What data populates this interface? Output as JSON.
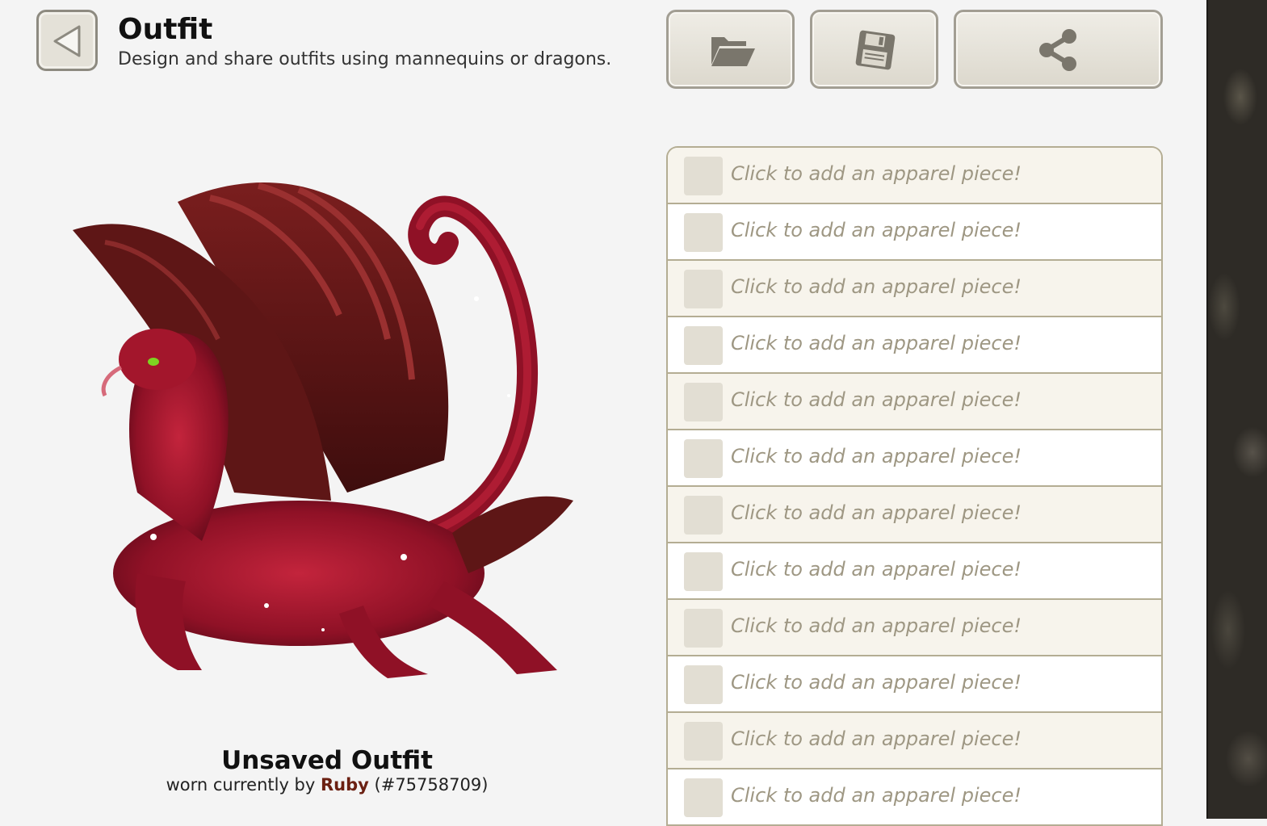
{
  "header": {
    "title": "Outfit",
    "subtitle": "Design and share outfits using mannequins or dragons."
  },
  "toolbar": {
    "back_icon": "back-arrow-icon",
    "open_icon": "folder-open-icon",
    "save_icon": "floppy-disk-icon",
    "share_icon": "share-icon"
  },
  "preview": {
    "outfit_name": "Unsaved Outfit",
    "worn_prefix": "worn currently by",
    "owner_name": "Ruby",
    "owner_id": "(#75758709)"
  },
  "apparel": {
    "slots": [
      {
        "label": "Click to add an apparel piece!"
      },
      {
        "label": "Click to add an apparel piece!"
      },
      {
        "label": "Click to add an apparel piece!"
      },
      {
        "label": "Click to add an apparel piece!"
      },
      {
        "label": "Click to add an apparel piece!"
      },
      {
        "label": "Click to add an apparel piece!"
      },
      {
        "label": "Click to add an apparel piece!"
      },
      {
        "label": "Click to add an apparel piece!"
      },
      {
        "label": "Click to add an apparel piece!"
      },
      {
        "label": "Click to add an apparel piece!"
      },
      {
        "label": "Click to add an apparel piece!"
      },
      {
        "label": "Click to add an apparel piece!"
      }
    ]
  },
  "colors": {
    "accent_owner": "#6b2012",
    "dragon_primary": "#a3162c",
    "dragon_wing": "#5e1616"
  }
}
